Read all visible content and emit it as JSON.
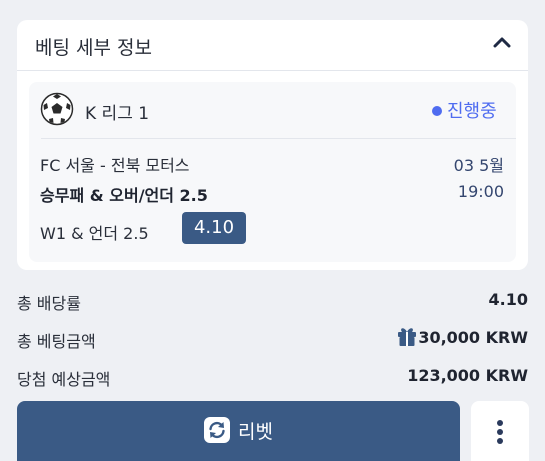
{
  "panel": {
    "title": "베팅 세부 정보"
  },
  "bet": {
    "league": "K 리그 1",
    "status": "진행중",
    "match": "FC 서울 - 전북 모터스",
    "date": "03 5월",
    "market": "승무패 & 오버/언더 2.5",
    "time": "19:00",
    "selection": "W1 & 언더 2.5",
    "odds": "4.10"
  },
  "summary": {
    "total_odds_label": "총 배당률",
    "total_odds_value": "4.10",
    "total_stake_label": "총 베팅금액",
    "total_stake_value": "30,000 KRW",
    "expected_win_label": "당첨 예상금액",
    "expected_win_value": "123,000 KRW"
  },
  "actions": {
    "rebet_label": "리벳"
  },
  "colors": {
    "accent": "#3a5a85",
    "status": "#4f6cf0"
  },
  "icons": [
    "chevron-up-icon",
    "soccer-ball-icon",
    "gift-icon",
    "refresh-icon",
    "more-vertical-icon"
  ]
}
